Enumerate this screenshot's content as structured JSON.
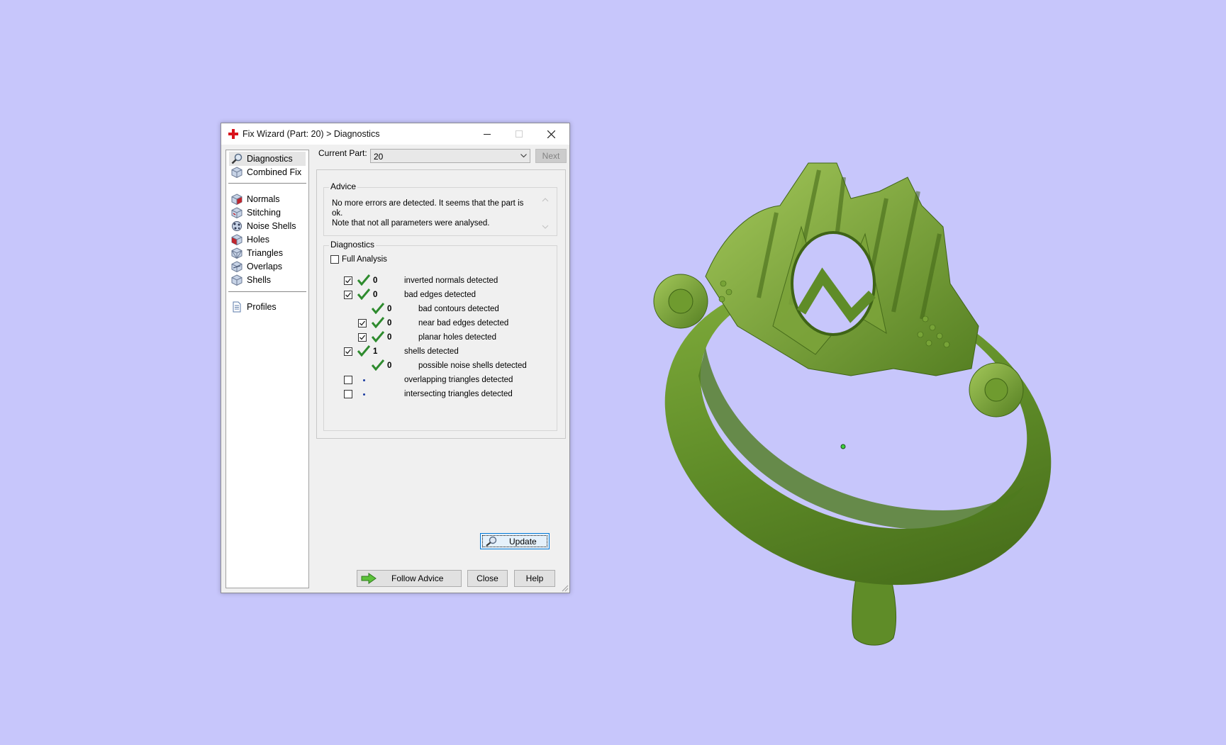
{
  "window": {
    "title": "Fix Wizard (Part: 20) > Diagnostics"
  },
  "sidebar": {
    "items": [
      {
        "label": "Diagnostics",
        "icon": "magnifier-icon",
        "selected": true
      },
      {
        "label": "Combined Fix",
        "icon": "cube-icon"
      },
      {
        "label": "Normals",
        "icon": "normals-cube-icon"
      },
      {
        "label": "Stitching",
        "icon": "stitching-cube-icon"
      },
      {
        "label": "Noise Shells",
        "icon": "noise-shells-icon"
      },
      {
        "label": "Holes",
        "icon": "holes-cube-icon"
      },
      {
        "label": "Triangles",
        "icon": "triangles-cube-icon"
      },
      {
        "label": "Overlaps",
        "icon": "overlaps-cube-icon"
      },
      {
        "label": "Shells",
        "icon": "shells-cube-icon"
      },
      {
        "label": "Profiles",
        "icon": "profiles-document-icon"
      }
    ]
  },
  "current_part": {
    "label": "Current Part:",
    "value": "20",
    "next_label": "Next"
  },
  "advice": {
    "title": "Advice",
    "line1": "No more errors are detected. It seems that the part is ok.",
    "line2": "Note that not all parameters were analysed."
  },
  "diagnostics": {
    "title": "Diagnostics",
    "full_analysis_label": "Full Analysis",
    "rows": [
      {
        "checked": true,
        "status": "ok",
        "count": "0",
        "label": "inverted normals detected"
      },
      {
        "checked": true,
        "status": "ok",
        "count": "0",
        "label": "bad edges detected"
      },
      {
        "checked": null,
        "status": "ok",
        "count": "0",
        "label": "bad contours detected"
      },
      {
        "checked": true,
        "status": "ok",
        "count": "0",
        "label": "near bad edges detected"
      },
      {
        "checked": true,
        "status": "ok",
        "count": "0",
        "label": "planar holes detected"
      },
      {
        "checked": true,
        "status": "ok",
        "count": "1",
        "label": "shells detected"
      },
      {
        "checked": null,
        "status": "ok",
        "count": "0",
        "label": "possible noise shells detected"
      },
      {
        "checked": false,
        "status": "not-analysed",
        "count": "",
        "label": "overlapping triangles detected"
      },
      {
        "checked": false,
        "status": "not-analysed",
        "count": "",
        "label": "intersecting triangles detected"
      }
    ],
    "update_label": "Update"
  },
  "footer": {
    "follow_advice_label": "Follow Advice",
    "close_label": "Close",
    "help_label": "Help"
  },
  "colors": {
    "background": "#c7c6fb",
    "model_green": "#6b9a2d",
    "check_green": "#2e8b2e",
    "title_icon_red": "#d9141b"
  }
}
